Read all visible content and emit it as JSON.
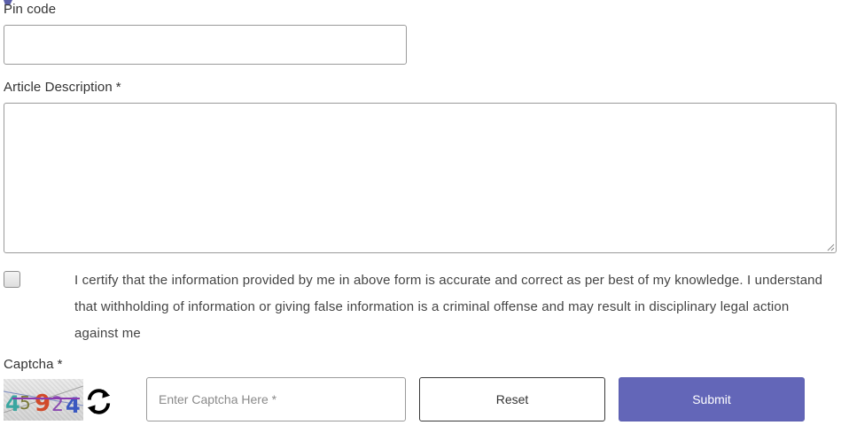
{
  "form": {
    "pin_code": {
      "label": "Pin code",
      "value": ""
    },
    "article_description": {
      "label": "Article Description",
      "required_marker": "*",
      "value": ""
    },
    "certification": {
      "checked": false,
      "text": "I certify that the information provided by me in above form is accurate and correct as per best of my knowledge. I understand that withholding of information or giving false information is a criminal offense and may result in disciplinary legal action against me"
    },
    "captcha": {
      "label": "Captcha",
      "required_marker": "*",
      "image_text": "45924",
      "input_placeholder": "Enter Captcha Here *",
      "input_value": ""
    },
    "buttons": {
      "reset_label": "Reset",
      "submit_label": "Submit"
    }
  },
  "colors": {
    "submit_bg": "#6366b8",
    "text": "#333333",
    "border": "#9a9a9a"
  }
}
